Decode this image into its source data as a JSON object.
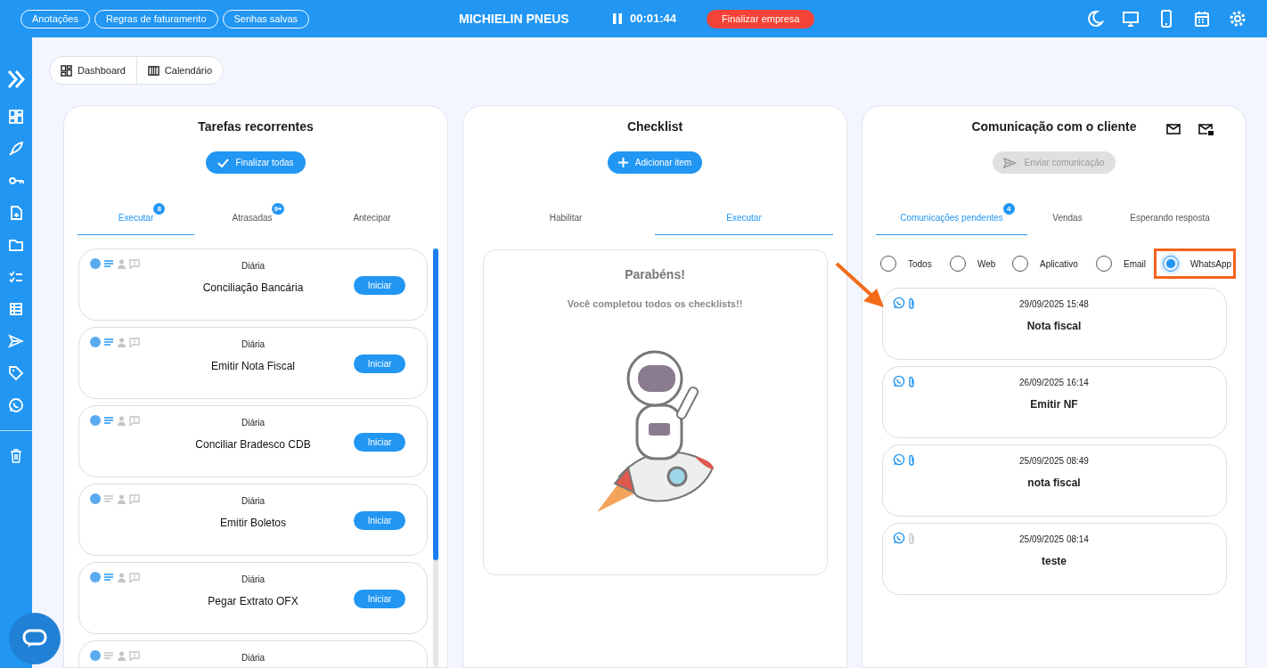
{
  "topbar": {
    "links": [
      "Anotações",
      "Regras de faturamento",
      "Senhas salvas"
    ],
    "company": "MICHIELIN PNEUS",
    "timer": "00:01:44",
    "finish_button": "Finalizar empresa"
  },
  "view_tabs": [
    {
      "label": "Dashboard",
      "selected": false
    },
    {
      "label": "Calendário",
      "selected": false
    }
  ],
  "recurring": {
    "title": "Tarefas recorrentes",
    "finish_all": "Finalizar todas",
    "tabs": [
      {
        "label": "Executar",
        "badge": "8",
        "selected": true
      },
      {
        "label": "Atrasadas",
        "badge": "9+",
        "selected": false
      },
      {
        "label": "Antecipar",
        "selected": false
      }
    ],
    "tasks": [
      {
        "frequency": "Diária",
        "title": "Conciliação Bancária",
        "action": "Iniciar",
        "has_description": true
      },
      {
        "frequency": "Diária",
        "title": "Emitir Nota Fiscal",
        "action": "Iniciar",
        "has_description": true
      },
      {
        "frequency": "Diária",
        "title": "Conciliar Bradesco CDB",
        "action": "Iniciar",
        "has_description": true
      },
      {
        "frequency": "Diária",
        "title": "Emitir Boletos",
        "action": "Iniciar",
        "has_description": false
      },
      {
        "frequency": "Diária",
        "title": "Pegar Extrato OFX",
        "action": "Iniciar",
        "has_description": true
      },
      {
        "frequency": "Diária",
        "has_description": false
      }
    ]
  },
  "checklist": {
    "title": "Checklist",
    "add_button": "Adicionar item",
    "tabs": [
      {
        "label": "Habilitar",
        "selected": false
      },
      {
        "label": "Executar",
        "selected": true
      }
    ],
    "empty_title": "Parabéns!",
    "empty_text": "Você completou todos os checklists!!"
  },
  "communication": {
    "title": "Comunicação com o cliente",
    "send_button": "Enviar comunicação",
    "tabs": [
      {
        "label": "Comunicações pendentes",
        "badge": "4",
        "selected": true
      },
      {
        "label": "Vendas",
        "selected": false
      },
      {
        "label": "Esperando resposta",
        "selected": false
      }
    ],
    "filters": [
      {
        "label": "Todos",
        "selected": false
      },
      {
        "label": "Web",
        "selected": false
      },
      {
        "label": "Aplicativo",
        "selected": false
      },
      {
        "label": "Email",
        "selected": false
      },
      {
        "label": "WhatsApp",
        "selected": true
      }
    ],
    "messages": [
      {
        "date": "29/09/2025 15:48",
        "title": "Nota fiscal",
        "attachment": true
      },
      {
        "date": "26/09/2025 16:14",
        "title": "Emitir NF",
        "attachment": true
      },
      {
        "date": "25/09/2025 08:49",
        "title": "nota fiscal",
        "attachment": true
      },
      {
        "date": "25/09/2025 08:14",
        "title": "teste",
        "attachment": false
      }
    ]
  }
}
